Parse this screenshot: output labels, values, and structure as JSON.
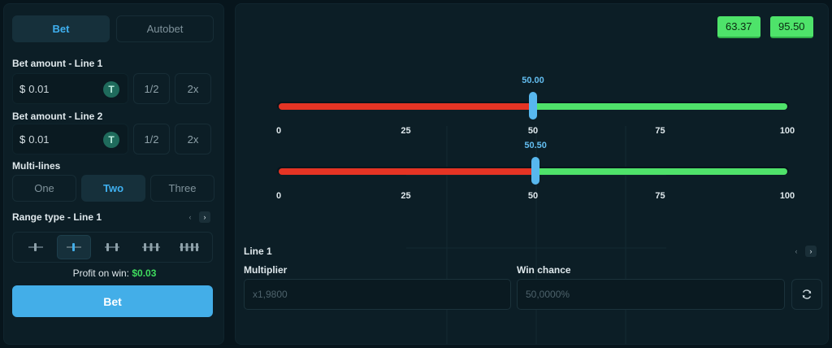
{
  "tabs": [
    {
      "label": "Bet",
      "active": true
    },
    {
      "label": "Autobet",
      "active": false
    }
  ],
  "bet_line1": {
    "label": "Bet amount - Line 1",
    "currency": "$",
    "value": "0.01",
    "token": "T",
    "half": "1/2",
    "double": "2x"
  },
  "bet_line2": {
    "label": "Bet amount - Line 2",
    "currency": "$",
    "value": "0.01",
    "token": "T",
    "half": "1/2",
    "double": "2x"
  },
  "multilines": {
    "label": "Multi-lines",
    "options": [
      "One",
      "Two",
      "Three"
    ],
    "selected": "Two"
  },
  "range_type": {
    "label": "Range type - Line 1",
    "prev": "‹",
    "next": "›",
    "options": [
      "range-1",
      "range-2",
      "range-3",
      "range-4",
      "range-5"
    ],
    "selected_index": 1
  },
  "profit": {
    "label": "Profit on win:",
    "amount": "$0.03"
  },
  "bet_button": "Bet",
  "results": [
    "63.37",
    "95.50"
  ],
  "sliders": [
    {
      "value": 50.0,
      "value_label": "50.00",
      "ticks": [
        "0",
        "25",
        "50",
        "75",
        "100"
      ]
    },
    {
      "value": 50.5,
      "value_label": "50.50",
      "ticks": [
        "0",
        "25",
        "50",
        "75",
        "100"
      ]
    }
  ],
  "line_section": {
    "label": "Line 1",
    "prev": "‹",
    "next": "›"
  },
  "multiplier": {
    "label": "Multiplier",
    "placeholder": "x1,9800"
  },
  "win_chance": {
    "label": "Win chance",
    "placeholder": "50,0000%"
  },
  "colors": {
    "accent": "#43aee8",
    "loss": "#e53424",
    "win": "#4fe26a"
  }
}
